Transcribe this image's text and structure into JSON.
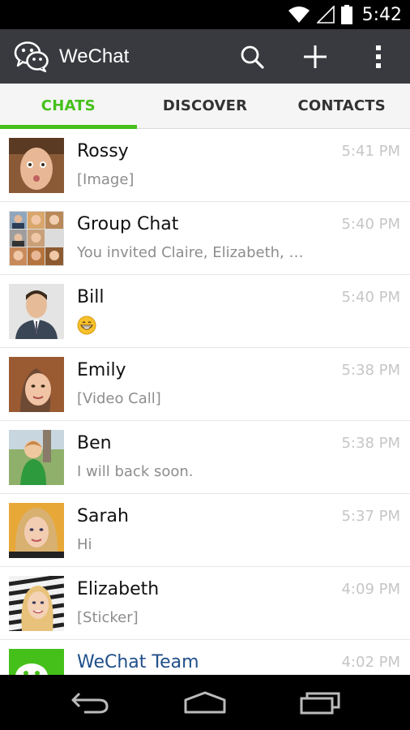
{
  "status_bar": {
    "time": "5:42",
    "icons": [
      "wifi-icon",
      "signal-icon",
      "battery-icon"
    ]
  },
  "action_bar": {
    "title": "WeChat",
    "icons": [
      "wechat-logo-icon",
      "search-icon",
      "plus-icon",
      "overflow-menu-icon"
    ]
  },
  "tabs": [
    {
      "label": "CHATS",
      "active": true
    },
    {
      "label": "DISCOVER",
      "active": false
    },
    {
      "label": "CONTACTS",
      "active": false
    }
  ],
  "chats": [
    {
      "name": "Rossy",
      "preview": "[Image]",
      "time": "5:41 PM"
    },
    {
      "name": "Group Chat",
      "preview": "You invited Claire, Elizabeth, E...",
      "time": "5:40 PM"
    },
    {
      "name": "Bill",
      "preview": "",
      "time": "5:40 PM",
      "emoji": "grinning-emoji-icon"
    },
    {
      "name": "Emily",
      "preview": "[Video Call]",
      "time": "5:38 PM"
    },
    {
      "name": "Ben",
      "preview": "I will back  soon.",
      "time": "5:38 PM"
    },
    {
      "name": "Sarah",
      "preview": "Hi",
      "time": "5:37 PM"
    },
    {
      "name": "Elizabeth",
      "preview": "[Sticker]",
      "time": "4:09 PM"
    },
    {
      "name": "WeChat Team",
      "preview": "",
      "time": "4:02 PM"
    }
  ],
  "nav_bar": {
    "icons": [
      "back-icon",
      "home-icon",
      "recents-icon"
    ]
  },
  "colors": {
    "accent": "#45c01a",
    "action_bar": "#393a3f",
    "team_name": "#1f4f8a"
  }
}
